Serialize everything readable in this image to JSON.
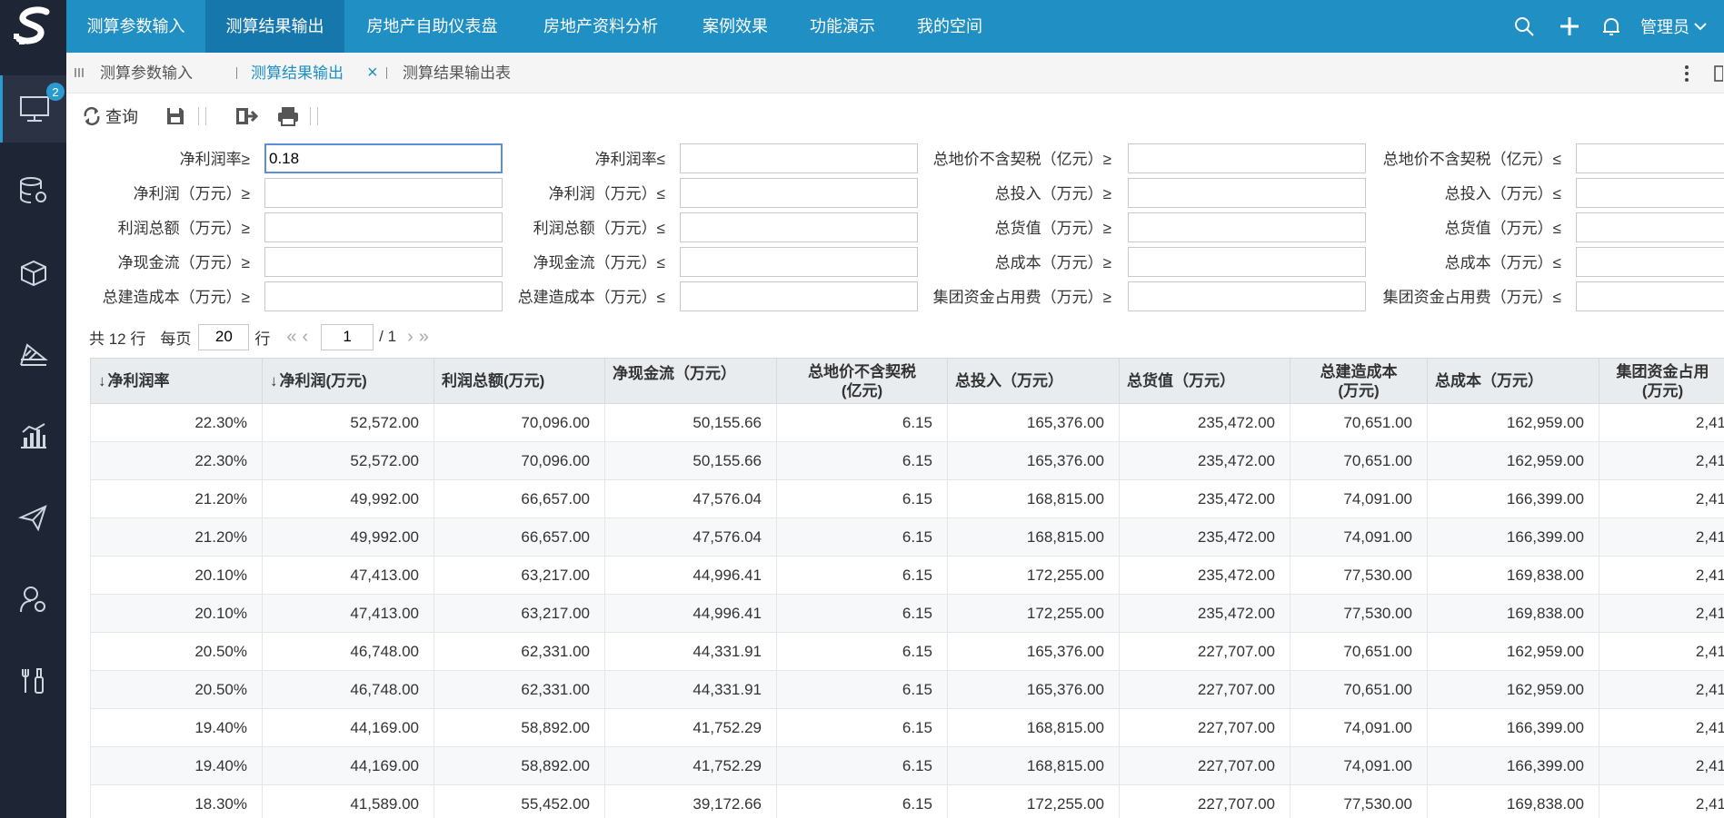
{
  "colors": {
    "nav": "#1f8fc4",
    "nav_active": "#1677ad",
    "sidebar": "#1e2534",
    "accent": "#2a9bd0"
  },
  "sidebar": {
    "badge": "2",
    "icons": [
      "monitor-icon",
      "database-gear-icon",
      "cubes-icon",
      "stairs-icon",
      "bar-chart-icon",
      "paper-plane-icon",
      "user-gear-icon",
      "tools-icon"
    ]
  },
  "topnav": {
    "tabs": [
      "测算参数输入",
      "测算结果输出",
      "房地产自助仪表盘",
      "房地产资料分析",
      "案例效果",
      "功能演示",
      "我的空间"
    ],
    "active": 1,
    "user": "管理员"
  },
  "tabstrip": {
    "tabs": [
      "测算参数输入",
      "测算结果输出",
      "测算结果输出表"
    ],
    "active": 1,
    "close_glyph": "×"
  },
  "toolbar": {
    "query_label": "查询"
  },
  "filters": {
    "rows": [
      [
        "净利润率≥",
        "净利润率≤",
        "总地价不含契税（亿元）≥",
        "总地价不含契税（亿元）≤"
      ],
      [
        "净利润（万元）≥",
        "净利润（万元）≤",
        "总投入（万元）≥",
        "总投入（万元）≤"
      ],
      [
        "利润总额（万元）≥",
        "利润总额（万元）≤",
        "总货值（万元）≥",
        "总货值（万元）≤"
      ],
      [
        "净现金流（万元）≥",
        "净现金流（万元）≤",
        "总成本（万元）≥",
        "总成本（万元）≤"
      ],
      [
        "总建造成本（万元）≥",
        "总建造成本（万元）≤",
        "集团资金占用费（万元）≥",
        "集团资金占用费（万元）≤"
      ]
    ],
    "first_value": "0.18"
  },
  "pager": {
    "total_text": "共 12 行",
    "per_page_label": "每页",
    "per_page": "20",
    "rows_unit": "行",
    "page": "1",
    "page_total": "/ 1"
  },
  "table": {
    "columns": [
      "净利润率",
      "净利润(万元)",
      "利润总额(万元)",
      "净现金流（万元）",
      "总地价不含契税（亿元）",
      "总投入（万元）",
      "总货值（万元）",
      "总建造成本（万元）",
      "总成本（万元）",
      "集团资金占用（万元）"
    ],
    "header_lines": [
      [
        "净利润率"
      ],
      [
        "净利润(万元)"
      ],
      [
        "利润总额(万元)"
      ],
      [
        "净现金流（万元）",
        ""
      ],
      [
        "总地价不含契税",
        "(亿元)"
      ],
      [
        "总投入（万元）"
      ],
      [
        "总货值（万元）"
      ],
      [
        "总建造成本",
        "(万元)"
      ],
      [
        "总成本（万元）"
      ],
      [
        "集团资金占用",
        "(万元)"
      ]
    ],
    "sort_arrow": "↓",
    "rows": [
      [
        "22.30%",
        "52,572.00",
        "70,096.00",
        "50,155.66",
        "6.15",
        "165,376.00",
        "235,472.00",
        "70,651.00",
        "162,959.00",
        "2,41"
      ],
      [
        "22.30%",
        "52,572.00",
        "70,096.00",
        "50,155.66",
        "6.15",
        "165,376.00",
        "235,472.00",
        "70,651.00",
        "162,959.00",
        "2,41"
      ],
      [
        "21.20%",
        "49,992.00",
        "66,657.00",
        "47,576.04",
        "6.15",
        "168,815.00",
        "235,472.00",
        "74,091.00",
        "166,399.00",
        "2,41"
      ],
      [
        "21.20%",
        "49,992.00",
        "66,657.00",
        "47,576.04",
        "6.15",
        "168,815.00",
        "235,472.00",
        "74,091.00",
        "166,399.00",
        "2,41"
      ],
      [
        "20.10%",
        "47,413.00",
        "63,217.00",
        "44,996.41",
        "6.15",
        "172,255.00",
        "235,472.00",
        "77,530.00",
        "169,838.00",
        "2,41"
      ],
      [
        "20.10%",
        "47,413.00",
        "63,217.00",
        "44,996.41",
        "6.15",
        "172,255.00",
        "235,472.00",
        "77,530.00",
        "169,838.00",
        "2,41"
      ],
      [
        "20.50%",
        "46,748.00",
        "62,331.00",
        "44,331.91",
        "6.15",
        "165,376.00",
        "227,707.00",
        "70,651.00",
        "162,959.00",
        "2,41"
      ],
      [
        "20.50%",
        "46,748.00",
        "62,331.00",
        "44,331.91",
        "6.15",
        "165,376.00",
        "227,707.00",
        "70,651.00",
        "162,959.00",
        "2,41"
      ],
      [
        "19.40%",
        "44,169.00",
        "58,892.00",
        "41,752.29",
        "6.15",
        "168,815.00",
        "227,707.00",
        "74,091.00",
        "166,399.00",
        "2,41"
      ],
      [
        "19.40%",
        "44,169.00",
        "58,892.00",
        "41,752.29",
        "6.15",
        "168,815.00",
        "227,707.00",
        "74,091.00",
        "166,399.00",
        "2,41"
      ],
      [
        "18.30%",
        "41,589.00",
        "55,452.00",
        "39,172.66",
        "6.15",
        "172,255.00",
        "227,707.00",
        "77,530.00",
        "169,838.00",
        "2,41"
      ]
    ]
  }
}
